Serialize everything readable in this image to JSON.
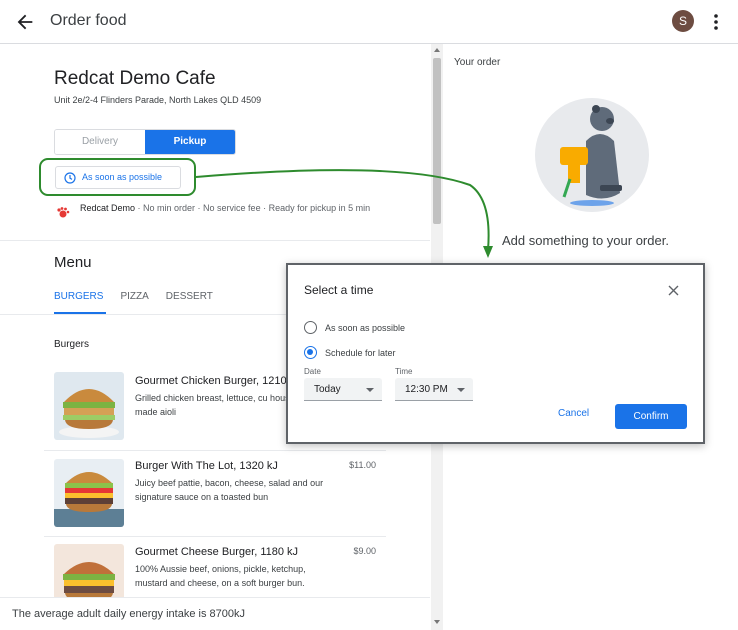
{
  "appbar": {
    "title": "Order food",
    "avatar_initial": "S"
  },
  "store": {
    "name": "Redcat Demo Cafe",
    "address": "Unit 2e/2-4 Flinders Parade, North Lakes QLD 4509",
    "mode_options": [
      "Delivery",
      "Pickup"
    ],
    "mode_selected": "Pickup",
    "time_button": "As soon as possible",
    "provider": "Redcat Demo",
    "info": " · No min order · No service fee · Ready for pickup in 5 min"
  },
  "menu": {
    "title": "Menu",
    "tabs": [
      "BURGERS",
      "PIZZA",
      "DESSERT"
    ],
    "active_tab": "BURGERS",
    "section": "Burgers",
    "items": [
      {
        "name": "Gourmet Chicken Burger,  1210",
        "desc": "Grilled chicken breast, lettuce, cu house-made aioli",
        "price": ""
      },
      {
        "name": "Burger With The Lot,  1320 kJ",
        "desc": "Juicy beef pattie, bacon, cheese, salad and our signature sauce on a toasted bun",
        "price": "$11.00"
      },
      {
        "name": "Gourmet Cheese Burger,  1180 kJ",
        "desc": "100% Aussie beef, onions, pickle, ketchup, mustard and cheese, on a soft burger bun.",
        "price": "$9.00"
      }
    ]
  },
  "footer": {
    "text": "The average adult daily energy intake is 8700kJ"
  },
  "order": {
    "title": "Your order",
    "empty_text": "Add something to your order."
  },
  "dialog": {
    "title": "Select a time",
    "option_asap": "As soon as possible",
    "option_later": "Schedule for later",
    "selected": "Schedule for later",
    "date_label": "Date",
    "date_value": "Today",
    "time_label": "Time",
    "time_value": "12:30 PM",
    "cancel": "Cancel",
    "confirm": "Confirm"
  },
  "colors": {
    "accent": "#1a73e8",
    "annotation": "#2e8b2e"
  }
}
